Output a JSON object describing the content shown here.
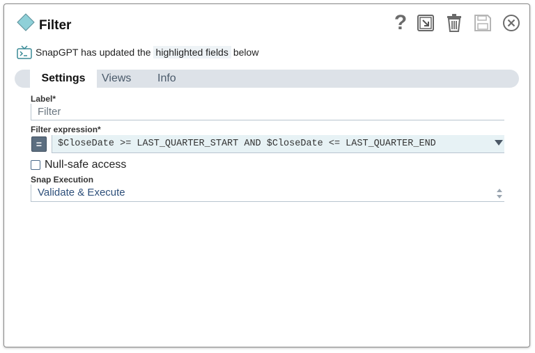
{
  "dialog": {
    "title": "Filter"
  },
  "toolbar": {
    "help_label": "?"
  },
  "snapgpt": {
    "prefix": "SnapGPT has updated the",
    "highlight": "highlighted fields",
    "suffix": "below"
  },
  "tabs": [
    {
      "label": "Settings",
      "active": true
    },
    {
      "label": "Views",
      "active": false
    },
    {
      "label": "Info",
      "active": false
    }
  ],
  "fields": {
    "label": {
      "title": "Label*",
      "value": "Filter"
    },
    "filter_expression": {
      "title": "Filter expression*",
      "toggle": "=",
      "value": "$CloseDate >= LAST_QUARTER_START AND $CloseDate <= LAST_QUARTER_END"
    },
    "null_safe": {
      "label": "Null-safe access",
      "checked": false
    },
    "snap_execution": {
      "title": "Snap Execution",
      "value": "Validate & Execute"
    }
  },
  "colors": {
    "diamond": "#8fd0d8",
    "tab_bar": "#dde2e8",
    "expr_bg": "#e7f2f5",
    "select_text": "#2d4f7a"
  },
  "icons": [
    "diamond-icon",
    "help-icon",
    "expand-icon",
    "trash-icon",
    "save-icon",
    "close-icon",
    "snapgpt-icon",
    "chevron-down-icon",
    "updown-arrows-icon"
  ]
}
